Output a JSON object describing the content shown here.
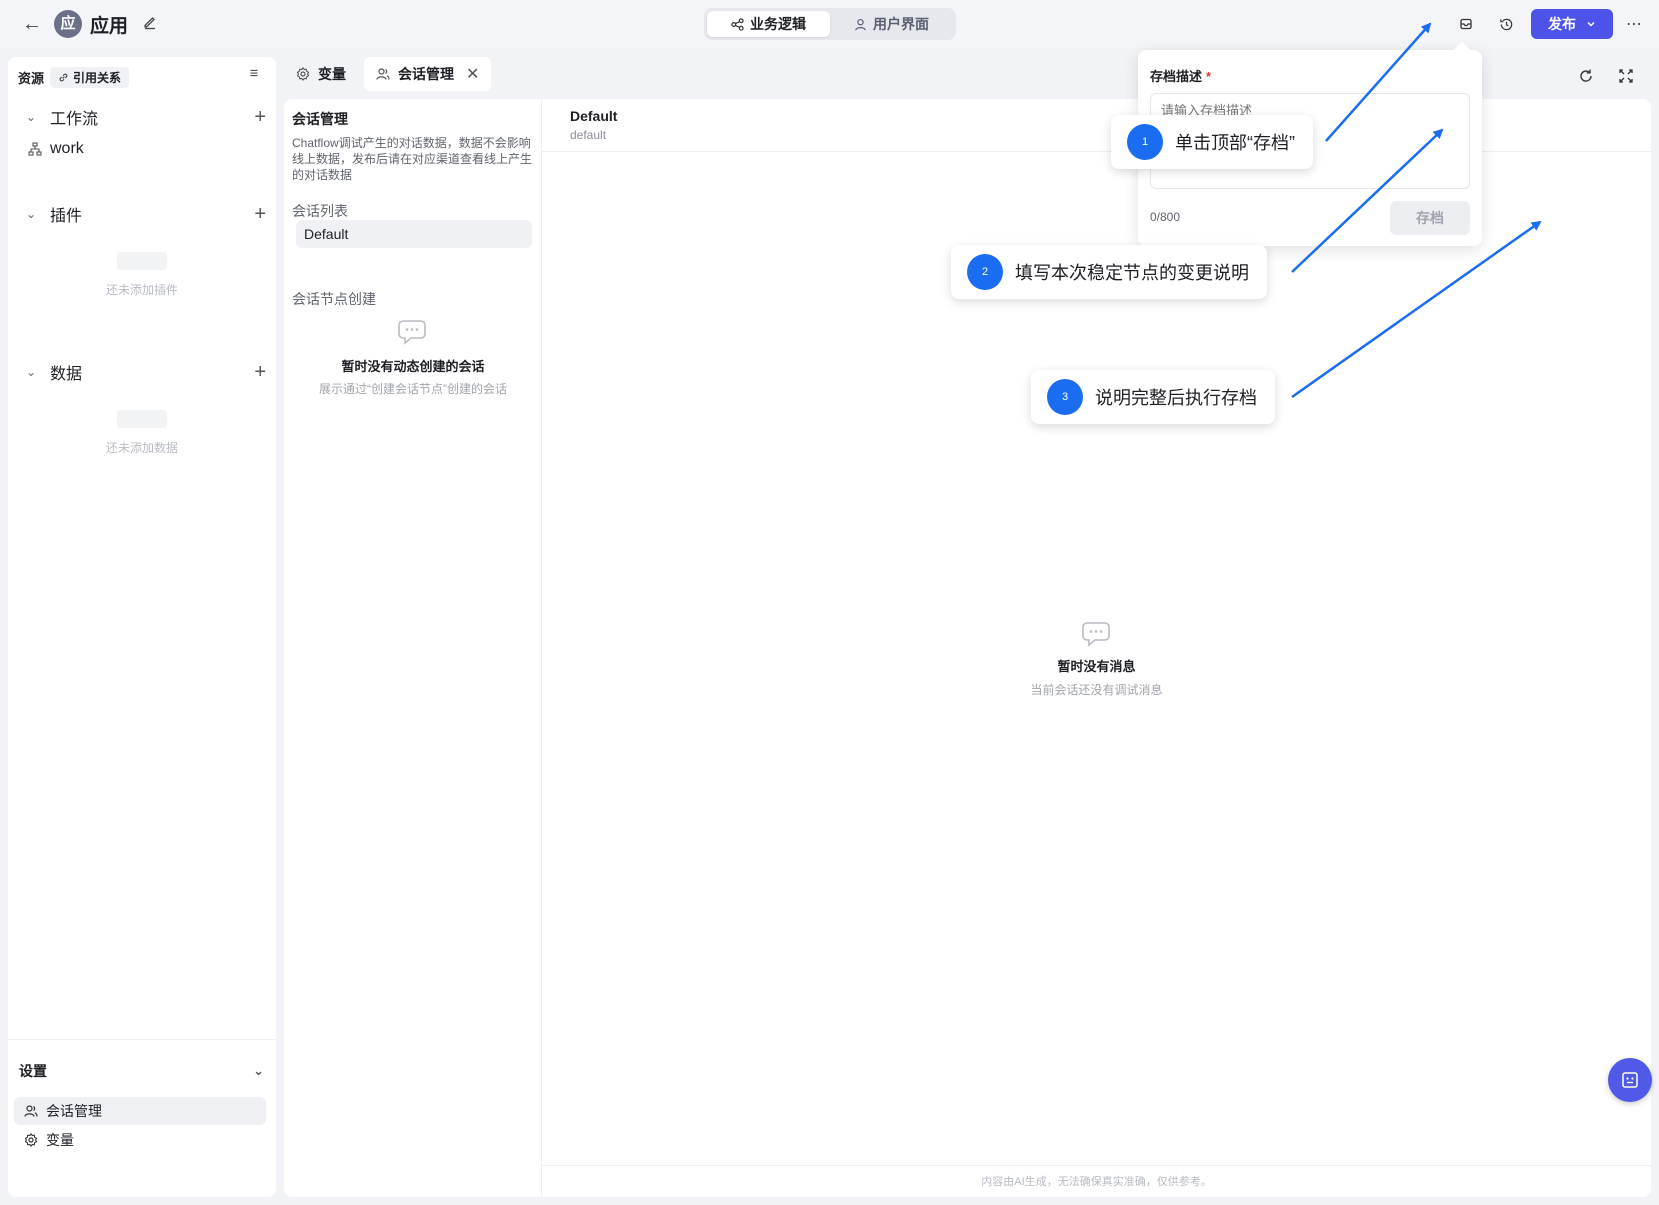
{
  "topbar": {
    "app_avatar": "应",
    "app_title": "应用",
    "modes": [
      "业务逻辑",
      "用户界面"
    ],
    "publish_label": "发布"
  },
  "sidebar": {
    "resources_label": "资源",
    "reference_label": "引用关系",
    "workflow_label": "工作流",
    "workflow_items": [
      "work"
    ],
    "plugin_label": "插件",
    "plugin_empty": "还未添加插件",
    "data_label": "数据",
    "data_empty": "还未添加数据",
    "settings_label": "设置",
    "settings_items": [
      "会话管理",
      "变量"
    ]
  },
  "tabs": [
    "变量",
    "会话管理"
  ],
  "conversation_panel": {
    "title": "会话管理",
    "description": "Chatflow调试产生的对话数据，数据不会影响线上数据，发布后请在对应渠道查看线上产生的对话数据",
    "list_label": "会话列表",
    "list_items": [
      "Default"
    ],
    "node_label": "会话节点创建",
    "empty_title": "暂时没有动态创建的会话",
    "empty_desc": "展示通过“创建会话节点”创建的会话"
  },
  "chat": {
    "name": "Default",
    "subname": "default",
    "empty_title": "暂时没有消息",
    "empty_desc": "当前会话还没有调试消息",
    "footer": "内容由AI生成，无法确保真实准确，仅供参考。"
  },
  "save_popover": {
    "label": "存档描述",
    "required_mark": "*",
    "placeholder": "请输入存档描述",
    "counter": "0/800",
    "save_label": "存档"
  },
  "annotations": [
    {
      "num": "1",
      "text": "单击顶部“存档”"
    },
    {
      "num": "2",
      "text": "填写本次稳定节点的变更说明"
    },
    {
      "num": "3",
      "text": "说明完整后执行存档"
    }
  ],
  "colors": {
    "accent": "#4d53e8",
    "annotation_blue": "#1a6cf0"
  }
}
